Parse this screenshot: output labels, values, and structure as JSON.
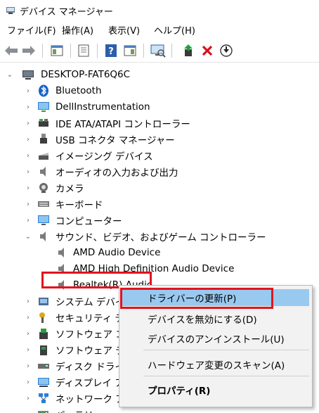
{
  "window": {
    "title": "デバイス マネージャー"
  },
  "menu": [
    "ファイル(F)",
    "操作(A)",
    "表示(V)",
    "ヘルプ(H)"
  ],
  "tree": {
    "root": "DESKTOP-FAT6Q6C",
    "categories": [
      "Bluetooth",
      "DellInstrumentation",
      "IDE ATA/ATAPI コントローラー",
      "USB コネクタ マネージャー",
      "イメージング デバイス",
      "オーディオの入力および出力",
      "カメラ",
      "キーボード",
      "コンピューター",
      "サウンド、ビデオ、およびゲーム コントローラー"
    ],
    "sound_children": [
      "AMD Audio Device",
      "AMD High Definition Audio Device",
      "Realtek(R) Audio"
    ],
    "lower_categories": [
      "システム デバイス",
      "セキュリティ デバ",
      "ソフトウェア コン",
      "ソフトウェア デバ",
      "ディスク ドライブ",
      "ディスプレイ アダ",
      "ネットワーク アダ",
      "バッテリ"
    ]
  },
  "context_menu": {
    "items": [
      "ドライバーの更新(P)",
      "デバイスを無効にする(D)",
      "デバイスのアンインストール(U)",
      "ハードウェア変更のスキャン(A)",
      "プロパティ(R)"
    ]
  },
  "colors": {
    "highlight": "#99c9ef",
    "callout": "#e0141e",
    "toolbar_accent": "#1f7fd1"
  }
}
